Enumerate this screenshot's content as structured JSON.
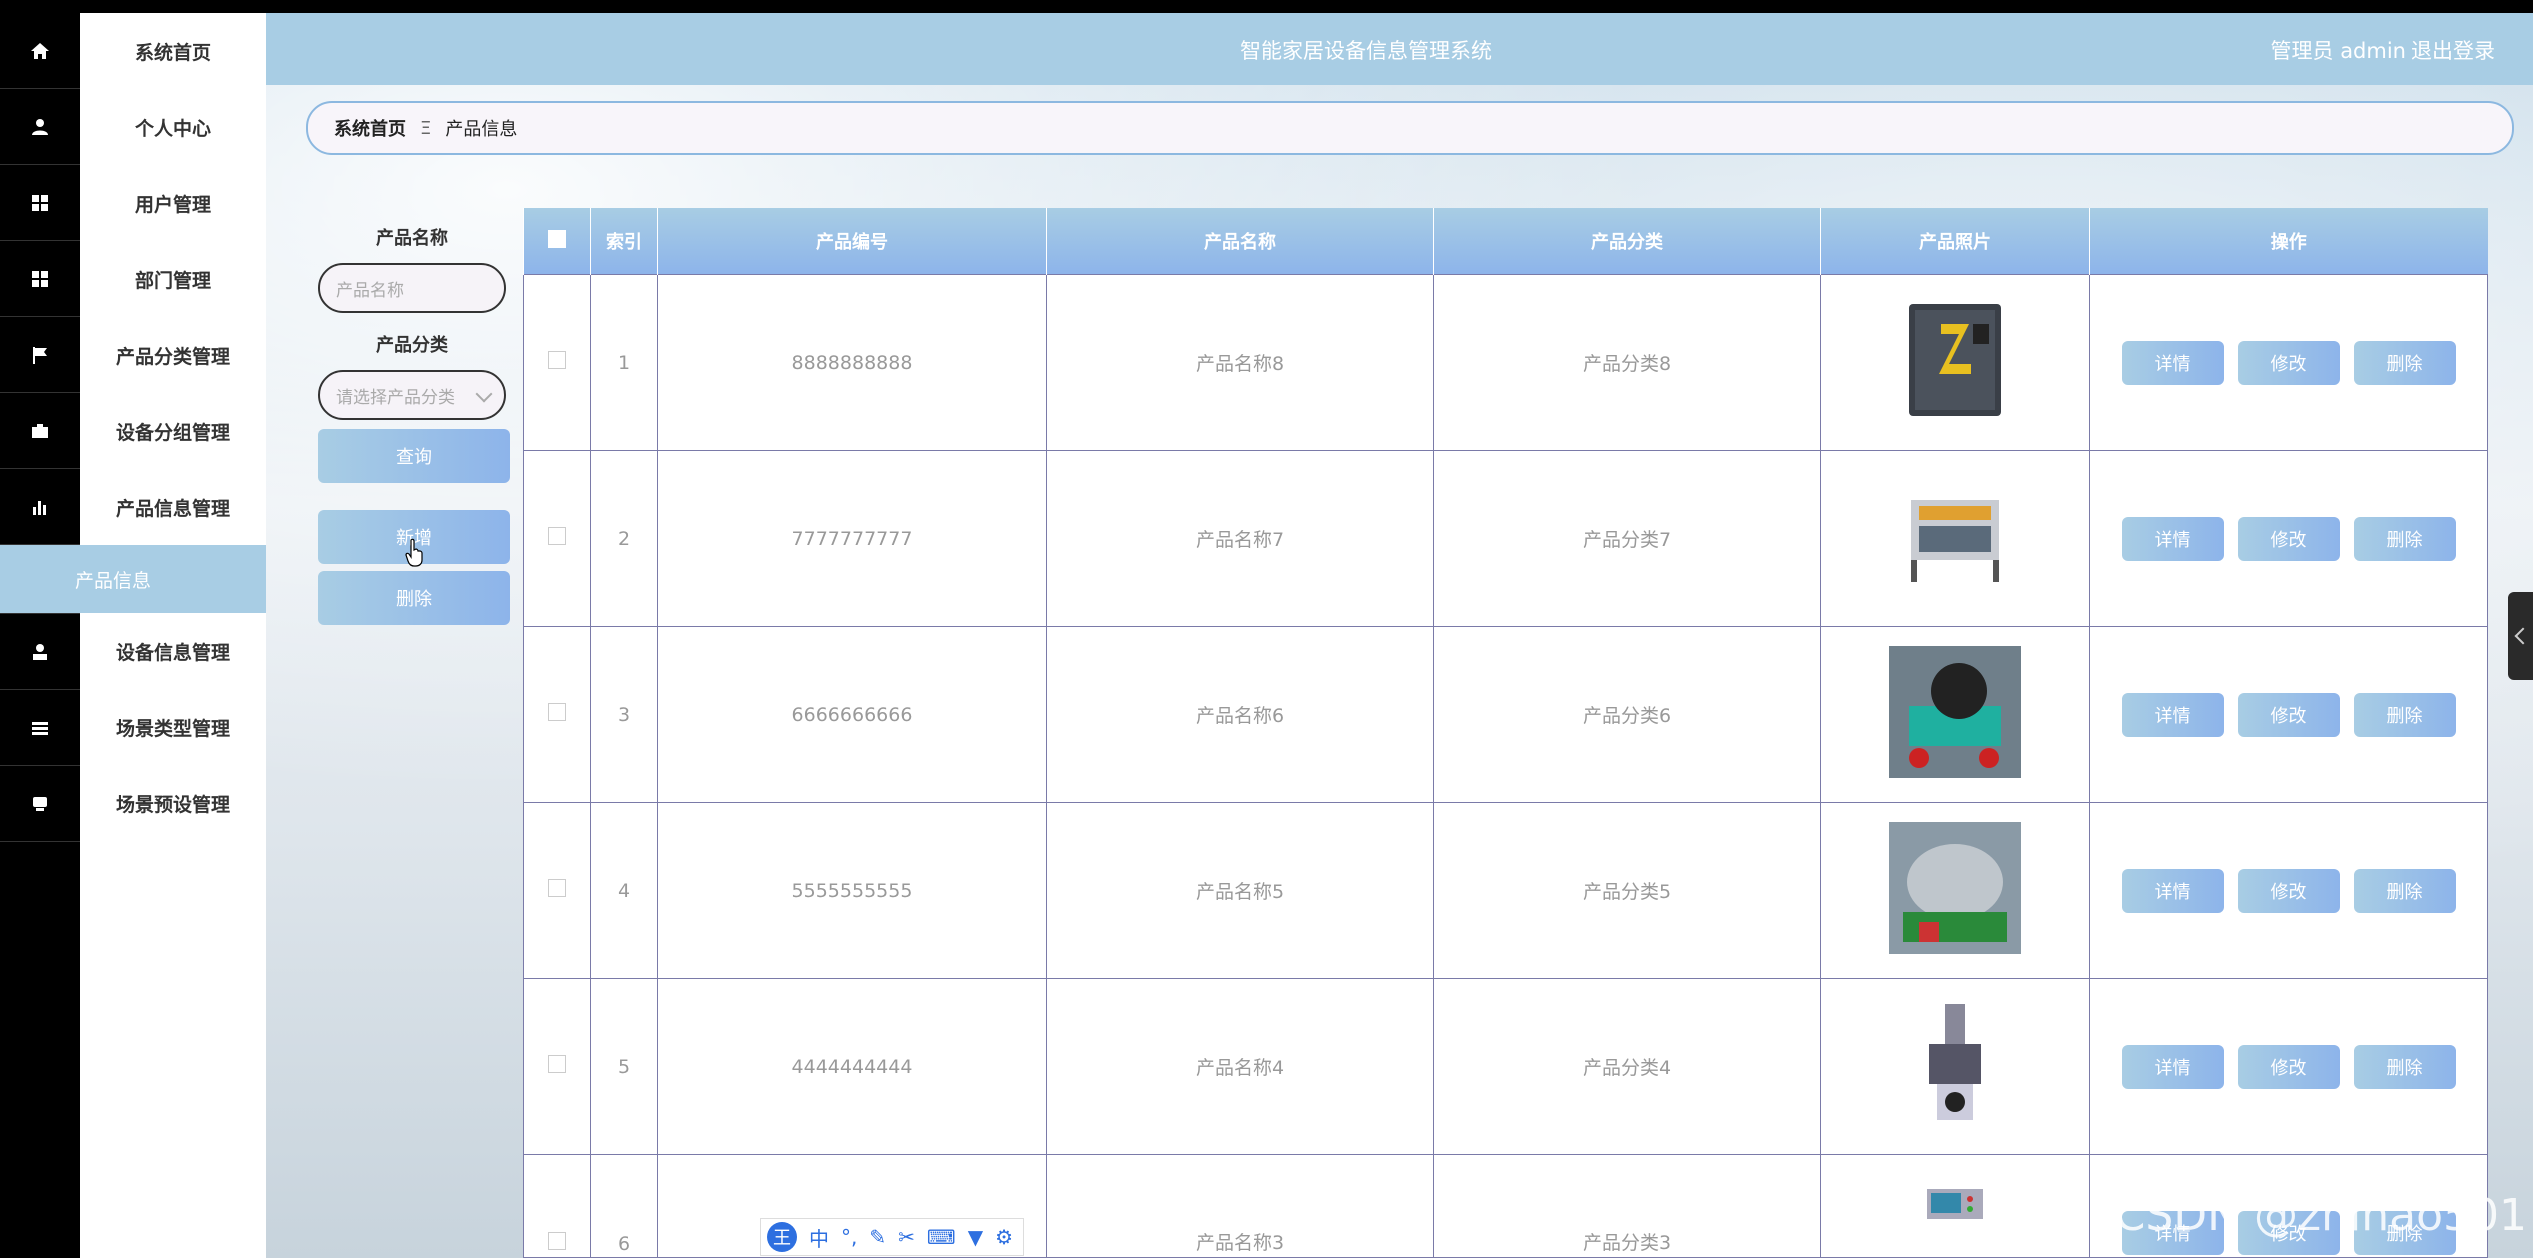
{
  "app": {
    "title": "智能家居设备信息管理系统",
    "user_label": "管理员 admin",
    "logout_label": "退出登录"
  },
  "menu": {
    "items": [
      {
        "label": "系统首页",
        "icon": "home-icon"
      },
      {
        "label": "个人中心",
        "icon": "user-icon"
      },
      {
        "label": "用户管理",
        "icon": "grid-icon"
      },
      {
        "label": "部门管理",
        "icon": "grid-icon"
      },
      {
        "label": "产品分类管理",
        "icon": "flag-icon"
      },
      {
        "label": "设备分组管理",
        "icon": "briefcase-icon"
      },
      {
        "label": "产品信息管理",
        "icon": "bar-chart-icon"
      },
      {
        "label": "设备信息管理",
        "icon": "person-icon"
      },
      {
        "label": "场景类型管理",
        "icon": "list-icon"
      },
      {
        "label": "场景预设管理",
        "icon": "device-icon"
      }
    ],
    "active_sub": "产品信息"
  },
  "breadcrumb": {
    "home": "系统首页",
    "separator": "Ξ",
    "current": "产品信息"
  },
  "search": {
    "name_label": "产品名称",
    "name_placeholder": "产品名称",
    "category_label": "产品分类",
    "category_placeholder": "请选择产品分类",
    "query_button": "查询",
    "add_button": "新增",
    "delete_button": "删除"
  },
  "table": {
    "headers": [
      "索引",
      "产品编号",
      "产品名称",
      "产品分类",
      "产品照片",
      "操作"
    ],
    "rows": [
      {
        "index": "1",
        "code": "8888888888",
        "name": "产品名称8",
        "category": "产品分类8",
        "photo": "compressor"
      },
      {
        "index": "2",
        "code": "7777777777",
        "name": "产品名称7",
        "category": "产品分类7",
        "photo": "machine-frame"
      },
      {
        "index": "3",
        "code": "6666666666",
        "name": "产品名称6",
        "category": "产品分类6",
        "photo": "motor-cart"
      },
      {
        "index": "4",
        "code": "5555555555",
        "name": "产品名称5",
        "category": "产品分类5",
        "photo": "drum-mixer"
      },
      {
        "index": "5",
        "code": "4444444444",
        "name": "产品名称4",
        "category": "产品分类4",
        "photo": "drill-press"
      },
      {
        "index": "6",
        "code": "",
        "name": "产品名称3",
        "category": "产品分类3",
        "photo": "control-panel"
      }
    ],
    "actions": {
      "detail": "详情",
      "edit": "修改",
      "delete": "删除"
    }
  },
  "ime": {
    "logo": "王",
    "mode": "中"
  },
  "watermark": "CSDN @zhihao501",
  "colors": {
    "accent": "#a8cde4",
    "button_gradient_end": "#8db4ea",
    "border": "#7a7aa8"
  }
}
